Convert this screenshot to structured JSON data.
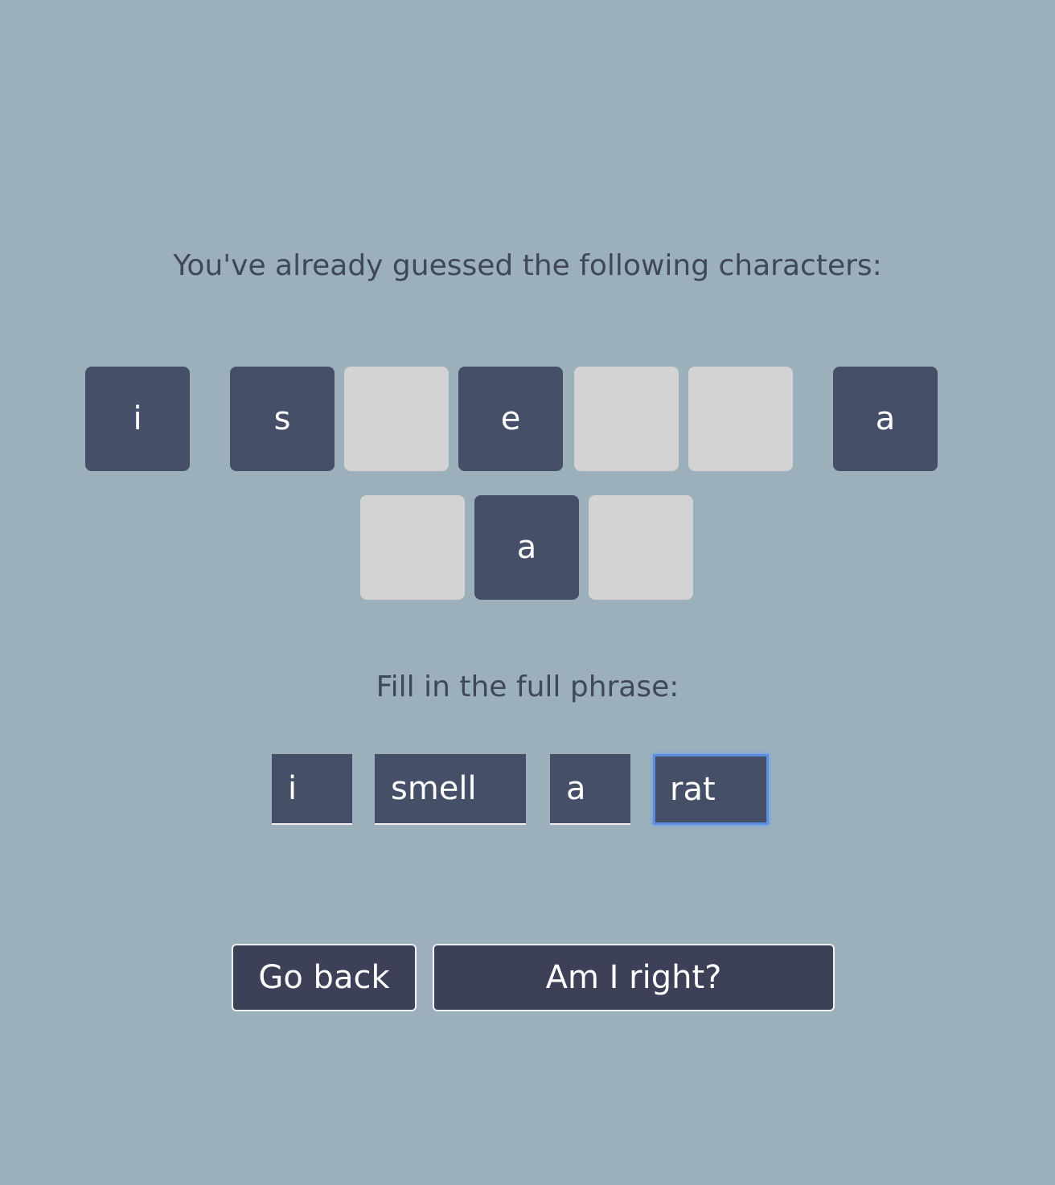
{
  "guessed": {
    "heading": "You've already guessed the following characters:",
    "row1": [
      {
        "char": "i",
        "revealed": true
      },
      {
        "char": "s",
        "revealed": true
      },
      {
        "char": "",
        "revealed": false
      },
      {
        "char": "e",
        "revealed": true
      },
      {
        "char": "",
        "revealed": false
      },
      {
        "char": "",
        "revealed": false
      },
      {
        "char": "a",
        "revealed": true
      }
    ],
    "row2": [
      {
        "char": "",
        "revealed": false
      },
      {
        "char": "a",
        "revealed": true
      },
      {
        "char": "",
        "revealed": false
      }
    ]
  },
  "phrase": {
    "heading": "Fill in the full phrase:",
    "words": [
      "i",
      "smell",
      "a",
      "rat"
    ]
  },
  "buttons": {
    "back_label": "Go back",
    "submit_label": "Am I right?"
  },
  "colors": {
    "background": "#9cb0bb",
    "tile_revealed": "#454f67",
    "tile_hidden": "#d3d3d3",
    "button": "#3c4157",
    "focus_ring": "#5b8fde"
  }
}
